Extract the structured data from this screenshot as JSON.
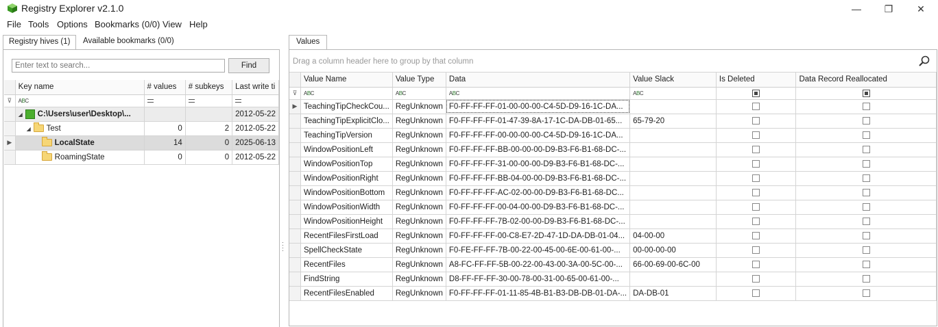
{
  "window": {
    "title": "Registry Explorer v2.1.0",
    "controls": {
      "minimize": "—",
      "maximize": "❐",
      "close": "✕"
    }
  },
  "menu": [
    "File",
    "Tools",
    "Options",
    "Bookmarks (0/0)",
    "View",
    "Help"
  ],
  "left": {
    "tabs": [
      "Registry hives (1)",
      "Available bookmarks (0/0)"
    ],
    "search_placeholder": "Enter text to search...",
    "find_label": "Find",
    "columns": [
      "Key name",
      "# values",
      "# subkeys",
      "Last write ti"
    ],
    "rows": [
      {
        "name": "C:\\Users\\user\\Desktop\\...",
        "values": "",
        "subkeys": "",
        "last_write": "2012-05-22"
      },
      {
        "name": "Test",
        "values": "0",
        "subkeys": "2",
        "last_write": "2012-05-22"
      },
      {
        "name": "LocalState",
        "values": "14",
        "subkeys": "0",
        "last_write": "2025-06-13"
      },
      {
        "name": "RoamingState",
        "values": "0",
        "subkeys": "0",
        "last_write": "2012-05-22"
      }
    ]
  },
  "right": {
    "tab": "Values",
    "group_hint": "Drag a column header here to group by that column",
    "columns": [
      "Value Name",
      "Value Type",
      "Data",
      "Value Slack",
      "Is Deleted",
      "Data Record Reallocated"
    ],
    "rows": [
      {
        "name": "TeachingTipCheckCou...",
        "type": "RegUnknown",
        "data": "F0-FF-FF-FF-01-00-00-00-C4-5D-D9-16-1C-DA...",
        "slack": ""
      },
      {
        "name": "TeachingTipExplicitClo...",
        "type": "RegUnknown",
        "data": "F0-FF-FF-FF-01-47-39-8A-17-1C-DA-DB-01-65...",
        "slack": "65-79-20"
      },
      {
        "name": "TeachingTipVersion",
        "type": "RegUnknown",
        "data": "F0-FF-FF-FF-00-00-00-00-C4-5D-D9-16-1C-DA...",
        "slack": ""
      },
      {
        "name": "WindowPositionLeft",
        "type": "RegUnknown",
        "data": "F0-FF-FF-FF-BB-00-00-00-D9-B3-F6-B1-68-DC-...",
        "slack": ""
      },
      {
        "name": "WindowPositionTop",
        "type": "RegUnknown",
        "data": "F0-FF-FF-FF-31-00-00-00-D9-B3-F6-B1-68-DC-...",
        "slack": ""
      },
      {
        "name": "WindowPositionRight",
        "type": "RegUnknown",
        "data": "F0-FF-FF-FF-BB-04-00-00-D9-B3-F6-B1-68-DC-...",
        "slack": ""
      },
      {
        "name": "WindowPositionBottom",
        "type": "RegUnknown",
        "data": "F0-FF-FF-FF-AC-02-00-00-D9-B3-F6-B1-68-DC...",
        "slack": ""
      },
      {
        "name": "WindowPositionWidth",
        "type": "RegUnknown",
        "data": "F0-FF-FF-FF-00-04-00-00-D9-B3-F6-B1-68-DC-...",
        "slack": ""
      },
      {
        "name": "WindowPositionHeight",
        "type": "RegUnknown",
        "data": "F0-FF-FF-FF-7B-02-00-00-D9-B3-F6-B1-68-DC-...",
        "slack": ""
      },
      {
        "name": "RecentFilesFirstLoad",
        "type": "RegUnknown",
        "data": "F0-FF-FF-FF-00-C8-E7-2D-47-1D-DA-DB-01-04...",
        "slack": "04-00-00"
      },
      {
        "name": "SpellCheckState",
        "type": "RegUnknown",
        "data": "F0-FE-FF-FF-7B-00-22-00-45-00-6E-00-61-00-...",
        "slack": "00-00-00-00"
      },
      {
        "name": "RecentFiles",
        "type": "RegUnknown",
        "data": "A8-FC-FF-FF-5B-00-22-00-43-00-3A-00-5C-00-...",
        "slack": "66-00-69-00-6C-00"
      },
      {
        "name": "FindString",
        "type": "RegUnknown",
        "data": "D8-FF-FF-FF-30-00-78-00-31-00-65-00-61-00-...",
        "slack": ""
      },
      {
        "name": "RecentFilesEnabled",
        "type": "RegUnknown",
        "data": "F0-FF-FF-FF-01-11-85-4B-B1-B3-DB-DB-01-DA-...",
        "slack": "DA-DB-01"
      }
    ]
  }
}
